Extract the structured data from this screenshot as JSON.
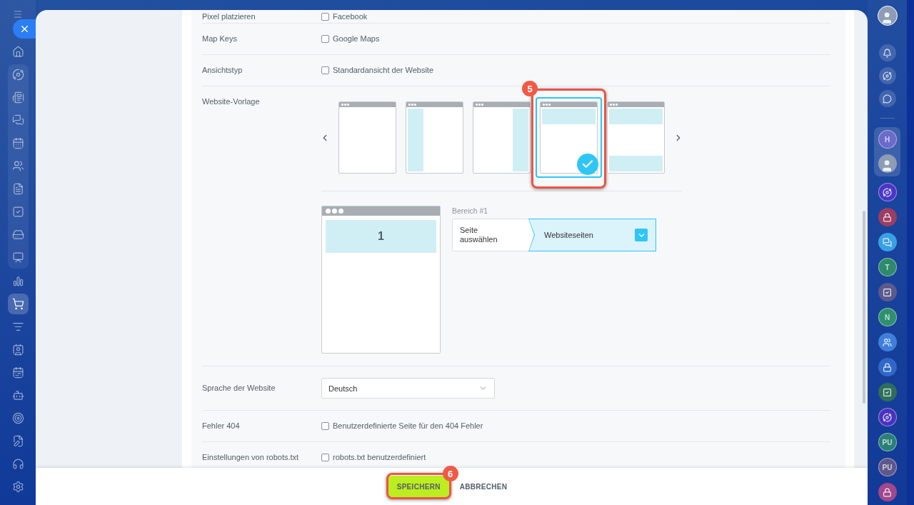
{
  "left_nav": {
    "sections": [
      {
        "grouped": false,
        "items": [
          {
            "selected": false
          }
        ]
      },
      {
        "grouped": true,
        "items": [
          {
            "selected": false
          },
          {
            "selected": false
          },
          {
            "selected": false
          },
          {
            "selected": false
          },
          {
            "selected": false
          },
          {
            "selected": false
          },
          {
            "selected": false
          },
          {
            "selected": false
          },
          {
            "selected": false
          }
        ]
      },
      {
        "grouped": false,
        "items": [
          {
            "selected": false
          },
          {
            "selected": true
          },
          {
            "selected": false
          },
          {
            "selected": false
          },
          {
            "selected": false
          },
          {
            "selected": false
          },
          {
            "selected": false
          },
          {
            "selected": false
          },
          {
            "selected": false
          },
          {
            "selected": false
          }
        ]
      }
    ]
  },
  "form": {
    "rows": [
      {
        "kind": "checkbox",
        "label": "Pixel platzieren",
        "option": "Facebook",
        "checked": false
      },
      {
        "kind": "checkbox",
        "label": "Map Keys",
        "option": "Google Maps",
        "checked": false
      },
      {
        "kind": "checkbox",
        "label": "Ansichtstyp",
        "option": "Standardansicht der Website",
        "checked": false
      },
      {
        "kind": "template",
        "label": "Website-Vorlage",
        "templates": [
          {
            "kind": "blank",
            "selected": false
          },
          {
            "kind": "left_column",
            "selected": false
          },
          {
            "kind": "right_column",
            "selected": false
          },
          {
            "kind": "header",
            "selected": true,
            "annotation": "5"
          },
          {
            "kind": "header_footer",
            "selected": false
          }
        ],
        "preview": {
          "areas": [
            {
              "number": "1"
            }
          ]
        },
        "area": {
          "title": "Bereich #1",
          "step": "Seite auswählen",
          "value": "Websiteseiten"
        }
      },
      {
        "kind": "select",
        "label": "Sprache der Website",
        "value": "Deutsch"
      },
      {
        "kind": "checkbox",
        "label": "Fehler 404",
        "option": "Benutzerdefinierte Seite für den 404 Fehler",
        "checked": false
      },
      {
        "kind": "checkbox",
        "label": "Einstellungen von robots.txt",
        "option": "robots.txt benutzerdefiniert",
        "checked": false
      }
    ]
  },
  "footer": {
    "buttons": [
      {
        "kind": "primary",
        "label": "SPEICHERN",
        "annotation": "6"
      },
      {
        "kind": "link",
        "label": "ABBRECHEN"
      }
    ]
  },
  "right_nav": {
    "top": [
      {
        "kind": "avatar"
      }
    ],
    "tools": [
      {
        "kind": "bell"
      },
      {
        "kind": "ring"
      },
      {
        "kind": "chat"
      }
    ],
    "pinned": [
      {
        "kind": "letter",
        "text": "H",
        "color": "#6c6bc9"
      },
      {
        "kind": "avatar"
      }
    ],
    "chats": [
      {
        "kind": "ring",
        "color": "#4b36c6"
      },
      {
        "kind": "lock",
        "color": "#9c3d63"
      },
      {
        "kind": "chat",
        "color": "#3aa0e6"
      },
      {
        "kind": "letter",
        "text": "T",
        "color": "#2e8a6b"
      },
      {
        "kind": "task",
        "color": "#5b5a8d"
      },
      {
        "kind": "letter",
        "text": "N",
        "color": "#2e906e"
      },
      {
        "kind": "people",
        "color": "#3f7fd9"
      },
      {
        "kind": "lock",
        "color": "#2f68c8"
      },
      {
        "kind": "task",
        "color": "#2e6f5b"
      },
      {
        "kind": "ring",
        "color": "#4a32c0"
      },
      {
        "kind": "letter",
        "text": "PU",
        "color": "#2a7f78"
      },
      {
        "kind": "letter",
        "text": "PU",
        "color": "#5c588b"
      },
      {
        "kind": "lock",
        "color": "#a1478d"
      }
    ]
  }
}
